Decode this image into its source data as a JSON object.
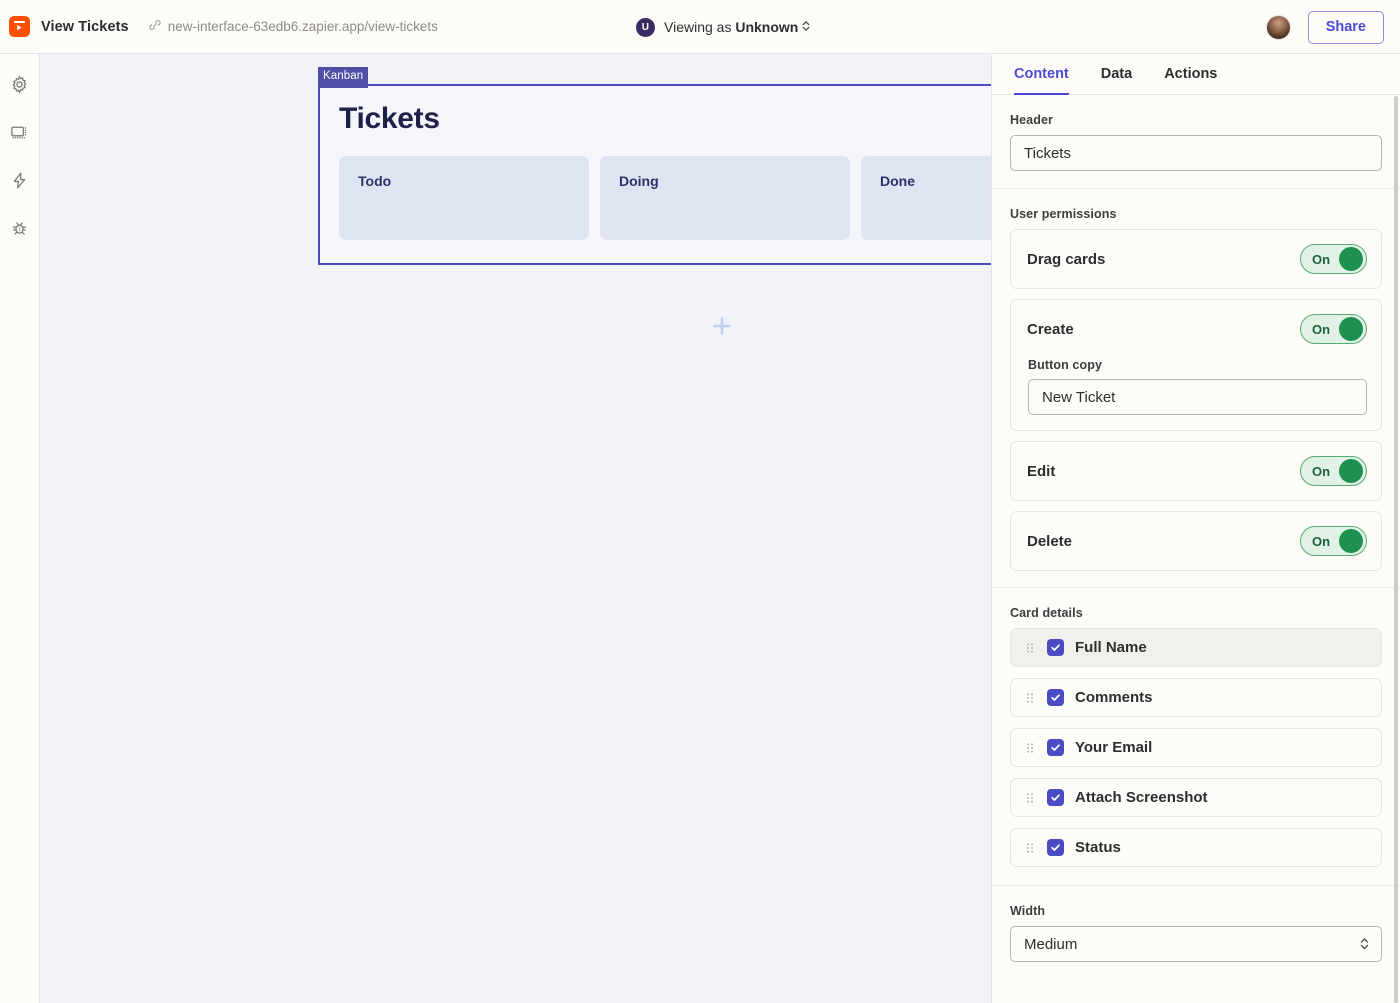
{
  "topbar": {
    "logo_icon": "zapier-logo-icon",
    "app_title": "View Tickets",
    "link_icon": "link-chain-icon",
    "url": "new-interface-63edb6.zapier.app/view-tickets",
    "viewing_avatar_initial": "U",
    "viewing_prefix": "Viewing as ",
    "viewing_name": "Unknown",
    "viewing_caret_icon": "chevron-up-down-icon",
    "user_avatar": "user-avatar",
    "share_label": "Share",
    "share_color": "#4b4bd4"
  },
  "rail": {
    "items": [
      {
        "icon": "gear-icon",
        "name": "settings"
      },
      {
        "icon": "display-icon",
        "name": "display"
      },
      {
        "icon": "lightning-bolt-icon",
        "name": "zaps"
      },
      {
        "icon": "bug-icon",
        "name": "debug"
      }
    ]
  },
  "canvas": {
    "block": {
      "badge": "Kanban",
      "badge_color": "#4f4fa8",
      "selection_color": "#4b4bc4",
      "title": "Tickets",
      "columns": [
        {
          "label": "Todo"
        },
        {
          "label": "Doing"
        },
        {
          "label": "Done"
        }
      ]
    },
    "add_block_icon": "plus-icon",
    "add_block_color": "#bed0f0",
    "background_color": "#f1f3f9"
  },
  "panel": {
    "tabs": [
      {
        "label": "Content",
        "active": true
      },
      {
        "label": "Data",
        "active": false
      },
      {
        "label": "Actions",
        "active": false
      }
    ],
    "header_section": {
      "label": "Header",
      "value": "Tickets",
      "placeholder": "Header"
    },
    "permissions_section": {
      "label": "User permissions",
      "items": [
        {
          "label": "Drag cards",
          "toggle": "On"
        },
        {
          "label": "Create",
          "toggle": "On",
          "sub_label": "Button copy",
          "sub_value": "New Ticket",
          "sub_placeholder": "Button copy"
        },
        {
          "label": "Edit",
          "toggle": "On"
        },
        {
          "label": "Delete",
          "toggle": "On"
        }
      ]
    },
    "card_details_section": {
      "label": "Card details",
      "items": [
        {
          "label": "Full Name",
          "checked": true,
          "highlighted": true
        },
        {
          "label": "Comments",
          "checked": true,
          "highlighted": false
        },
        {
          "label": "Your Email",
          "checked": true,
          "highlighted": false
        },
        {
          "label": "Attach Screenshot",
          "checked": true,
          "highlighted": false
        },
        {
          "label": "Status",
          "checked": true,
          "highlighted": false
        }
      ]
    },
    "width_section": {
      "label": "Width",
      "value": "Medium"
    }
  }
}
